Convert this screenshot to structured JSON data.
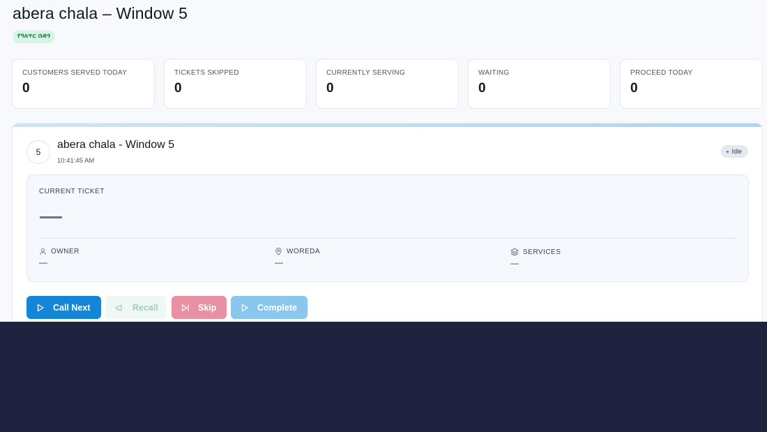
{
  "page": {
    "title": "abera chala – Window 5",
    "department_badge": "የዓለጥር ቡድን"
  },
  "stats": [
    {
      "label": "CUSTOMERS SERVED TODAY",
      "value": "0"
    },
    {
      "label": "TICKETS SKIPPED",
      "value": "0"
    },
    {
      "label": "CURRENTLY SERVING",
      "value": "0"
    },
    {
      "label": "WAITING",
      "value": "0"
    },
    {
      "label": "PROCEED TODAY",
      "value": "0"
    }
  ],
  "window": {
    "number": "5",
    "title": "abera chala - Window 5",
    "time": "10:41:45 AM",
    "status": "Idle",
    "current_ticket_label": "CURRENT TICKET",
    "owner_label": "OWNER",
    "owner_value": "—",
    "woreda_label": "WOREDA",
    "woreda_value": "—",
    "services_label": "SERVICES",
    "services_value": "—"
  },
  "actions": {
    "call_next": "Call Next",
    "recall": "Recall",
    "skip": "Skip",
    "complete": "Complete"
  },
  "icons": {
    "owner": "user-icon",
    "woreda": "map-pin-icon",
    "services": "layers-icon",
    "call_next": "play-icon",
    "recall": "megaphone-icon",
    "skip": "skip-forward-icon",
    "complete": "play-icon"
  },
  "colors": {
    "primary": "#1387d6",
    "skip": "#e891a3",
    "complete": "#89c7ef",
    "badge_bg": "#d7f5e6",
    "badge_text": "#147a4a",
    "footer": "#1f2340"
  }
}
